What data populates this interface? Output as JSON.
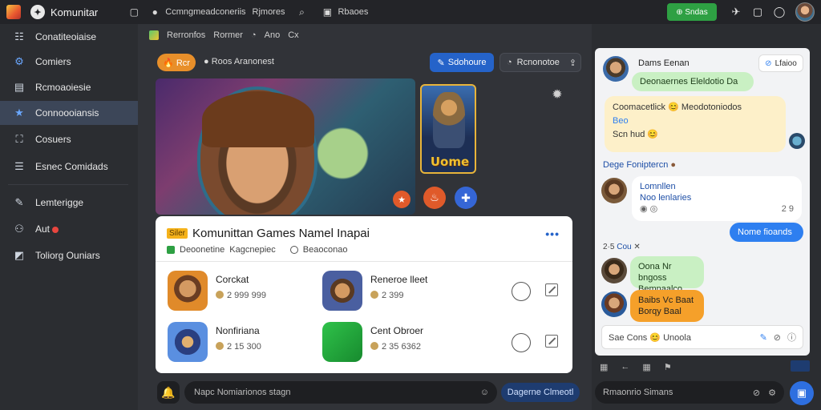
{
  "topbar": {
    "app_title": "Komunitar",
    "breadcrumb_text": "Ccmngmeadconeriis",
    "section_label": "Rjmores",
    "nav_label": "Rbaoes",
    "action_button": "⊕ Sndas",
    "accent": "#2ea043"
  },
  "sidebar": {
    "items": [
      {
        "label": "Conatiteoiaise",
        "icon": "grid-icon"
      },
      {
        "label": "Comiers",
        "icon": "gear-icon"
      },
      {
        "label": "Rcmoaoiesie",
        "icon": "list-icon"
      },
      {
        "label": "Connoooiansis",
        "icon": "star-icon"
      },
      {
        "label": "Cosuers",
        "icon": "users-icon"
      },
      {
        "label": "Esnec Comidads",
        "icon": "document-icon"
      },
      {
        "label": "Lemterigge",
        "icon": "edit-icon"
      },
      {
        "label": "Aut",
        "icon": "people-icon"
      },
      {
        "label": "Toliorg Ouniars",
        "icon": "tag-icon"
      }
    ]
  },
  "main": {
    "breadcrumb": [
      "Rerronfos",
      "Rormer",
      "Ano",
      "Cx"
    ],
    "filter_pill": "🔥 Rcr",
    "status_text": "Roos Aranonest",
    "primary_button": "Sdohoure",
    "secondary_button": "Rcnonotoe",
    "thumb_title": "Uome"
  },
  "card": {
    "tag": "Siler",
    "title": "Komunittan Games Namel Inapai",
    "sub_a": "Deoonetine",
    "sub_b": "Kagcnepiec",
    "sub_c": "Beaoconao",
    "games": [
      {
        "name": "Corckat",
        "stat": "2 999 999"
      },
      {
        "name": "Reneroe lleet",
        "stat": "2 399"
      },
      {
        "name": "Nonfiriana",
        "stat": "2 15 300"
      },
      {
        "name": "Cent Obroer",
        "stat": "2 35 6362"
      }
    ]
  },
  "chat": {
    "header_name": "Dams Eenan",
    "header_button": "Lfaioo",
    "messages": [
      {
        "text": "Deonaernes Eleldotio Da"
      },
      {
        "text": "Coomacetlick 😊 Meodotoniodos",
        "line2": "Beo",
        "line3": "Scn hud 😊"
      },
      {
        "text": "Dege Foniptercn"
      },
      {
        "text": "Noo lenlaries",
        "line1": "Lomnllen",
        "line3": "2 9",
        "meta": "2·5"
      },
      {
        "text": "Nome fioands"
      },
      {
        "text": "Oona Nr bngoss",
        "line2": "Bemnaalco"
      },
      {
        "text": "Baibs Vc Baat",
        "line2": "Borqy Baal"
      }
    ],
    "time_label": "2·5",
    "name_label": "Cou",
    "input_placeholder": "Sae Cons 😊 Unoola"
  },
  "bottom": {
    "input_placeholder": "Napc Nomiarionos stagn",
    "button": "Dagerne Clmeotl",
    "input2_placeholder": "Rmaonrio Simans"
  }
}
